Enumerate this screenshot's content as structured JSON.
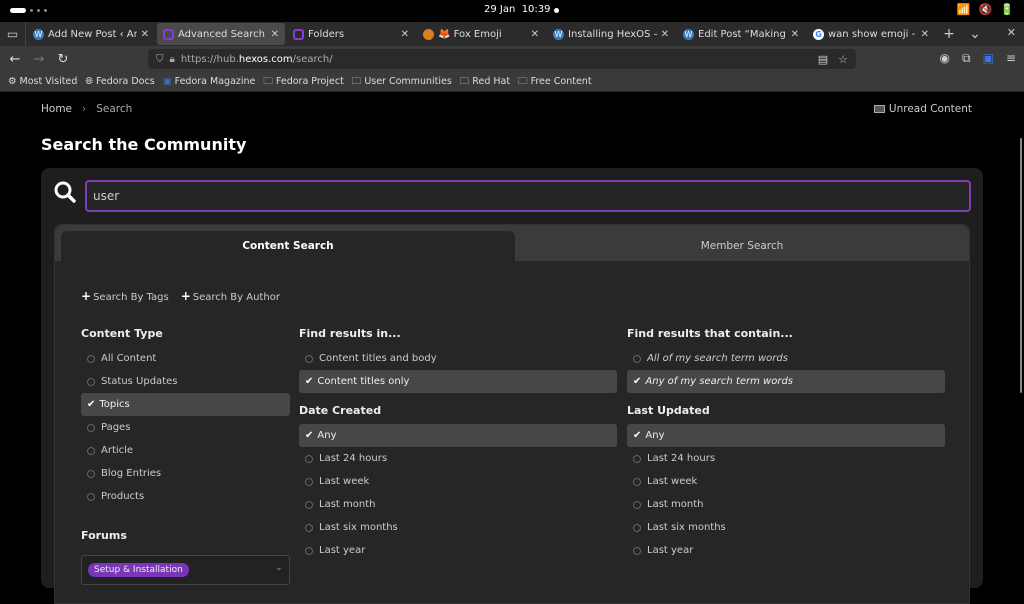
{
  "system": {
    "date": "29 Jan",
    "time": "10:39"
  },
  "tabs": [
    {
      "title": "Add New Post ‹ Anna",
      "icon": "wordpress-icon",
      "icon_color": "#3a7bbf",
      "active": false
    },
    {
      "title": "Advanced Search - H",
      "icon": "hexos-icon",
      "icon_color": "#8a3bd6",
      "active": true
    },
    {
      "title": "Folders",
      "icon": "hexos-icon",
      "icon_color": "#8a3bd6",
      "active": false
    },
    {
      "title": "🦊 Fox Emoji",
      "icon": "shield-extension-icon",
      "icon_color": "#e07b1f",
      "active": false
    },
    {
      "title": "Installing HexOS – An",
      "icon": "wordpress-icon",
      "icon_color": "#3a7bbf",
      "active": false
    },
    {
      "title": "Edit Post “Making my",
      "icon": "wordpress-icon",
      "icon_color": "#3a7bbf",
      "active": false
    },
    {
      "title": "wan show emoji - Go",
      "icon": "google-icon",
      "icon_color": "#ffffff",
      "active": false
    }
  ],
  "url": {
    "prefix": "https://hub.",
    "host": "hexos.com",
    "path": "/search/"
  },
  "bookmarks": [
    {
      "label": "Most Visited",
      "icon": "gear-icon"
    },
    {
      "label": "Fedora Docs",
      "icon": "globe-icon"
    },
    {
      "label": "Fedora Magazine",
      "icon": "fedora-magazine-icon"
    },
    {
      "label": "Fedora Project",
      "icon": "folder-icon"
    },
    {
      "label": "User Communities",
      "icon": "folder-icon"
    },
    {
      "label": "Red Hat",
      "icon": "folder-icon"
    },
    {
      "label": "Free Content",
      "icon": "folder-icon"
    }
  ],
  "breadcrumb": {
    "home": "Home",
    "separator": "›",
    "current": "Search"
  },
  "unread_content": "Unread Content",
  "page_title": "Search the Community",
  "search": {
    "value": "user"
  },
  "search_tabs": {
    "content": "Content Search",
    "member": "Member Search"
  },
  "adders": {
    "tags": "Search By Tags",
    "author": "Search By Author"
  },
  "content_type": {
    "heading": "Content Type",
    "options": [
      {
        "label": "All Content",
        "selected": false
      },
      {
        "label": "Status Updates",
        "selected": false
      },
      {
        "label": "Topics",
        "selected": true
      },
      {
        "label": "Pages",
        "selected": false
      },
      {
        "label": "Article",
        "selected": false
      },
      {
        "label": "Blog Entries",
        "selected": false
      },
      {
        "label": "Products",
        "selected": false
      }
    ]
  },
  "find_in": {
    "heading": "Find results in...",
    "options": [
      {
        "label": "Content titles and body",
        "selected": false
      },
      {
        "label": "Content titles only",
        "selected": true
      }
    ]
  },
  "contain": {
    "heading": "Find results that contain...",
    "options": [
      {
        "label": "All of my search term words",
        "selected": false
      },
      {
        "label": "Any of my search term words",
        "selected": true
      }
    ]
  },
  "date_created": {
    "heading": "Date Created",
    "options": [
      {
        "label": "Any",
        "selected": true
      },
      {
        "label": "Last 24 hours",
        "selected": false
      },
      {
        "label": "Last week",
        "selected": false
      },
      {
        "label": "Last month",
        "selected": false
      },
      {
        "label": "Last six months",
        "selected": false
      },
      {
        "label": "Last year",
        "selected": false
      }
    ]
  },
  "last_updated": {
    "heading": "Last Updated",
    "options": [
      {
        "label": "Any",
        "selected": true
      },
      {
        "label": "Last 24 hours",
        "selected": false
      },
      {
        "label": "Last week",
        "selected": false
      },
      {
        "label": "Last month",
        "selected": false
      },
      {
        "label": "Last six months",
        "selected": false
      },
      {
        "label": "Last year",
        "selected": false
      }
    ]
  },
  "forums": {
    "heading": "Forums",
    "selected_tag": "Setup & Installation"
  },
  "colors": {
    "accent": "#7e3bb5",
    "tag": "#7a36b8"
  }
}
